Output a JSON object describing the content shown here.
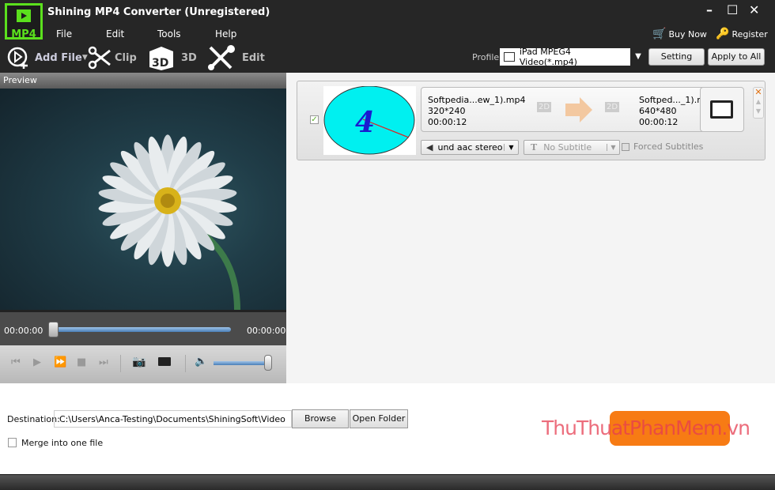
{
  "app": {
    "title": "Shining MP4 Converter (Unregistered)",
    "logo_text": "MP4"
  },
  "menu": [
    "File",
    "Edit",
    "Tools",
    "Help"
  ],
  "window_controls": {
    "minimize": "–",
    "maximize": "☐",
    "close": "✕"
  },
  "header_links": {
    "buy_now": "Buy Now",
    "register": "Register"
  },
  "toolbar": {
    "add_file": "Add File",
    "clip": "Clip",
    "three_d": "3D",
    "edit": "Edit"
  },
  "profile": {
    "label": "Profile:",
    "value": "iPad MPEG4 Video(*.mp4)",
    "setting": "Setting",
    "apply_all": "Apply to All"
  },
  "preview": {
    "header": "Preview",
    "time_start": "00:00:00",
    "time_end": "00:00:00",
    "volume": 0.95,
    "progress": 0
  },
  "file_item": {
    "checked": true,
    "thumb_digit": "4",
    "source": {
      "name": "Softpedia...ew_1).mp4",
      "resolution": "320*240",
      "duration": "00:00:12",
      "mode": "2D"
    },
    "output": {
      "name": "Softped..._1).mp4",
      "resolution": "640*480",
      "duration": "00:00:12",
      "mode": "2D"
    },
    "audio": "und aac stereo",
    "subtitle": "No Subtitle",
    "forced_subtitles": "Forced Subtitles",
    "forced_checked": false
  },
  "destination": {
    "label": "Destination:",
    "path": "C:\\Users\\Anca-Testing\\Documents\\ShiningSoft\\Video",
    "browse": "Browse",
    "open_folder": "Open Folder"
  },
  "merge": {
    "label": "Merge into one file",
    "checked": false
  },
  "watermark": "ThuThuatPhanMem.vn",
  "colors": {
    "accent_green": "#5be01d",
    "convert_orange": "#f77b14",
    "dark_bg": "#262626"
  }
}
